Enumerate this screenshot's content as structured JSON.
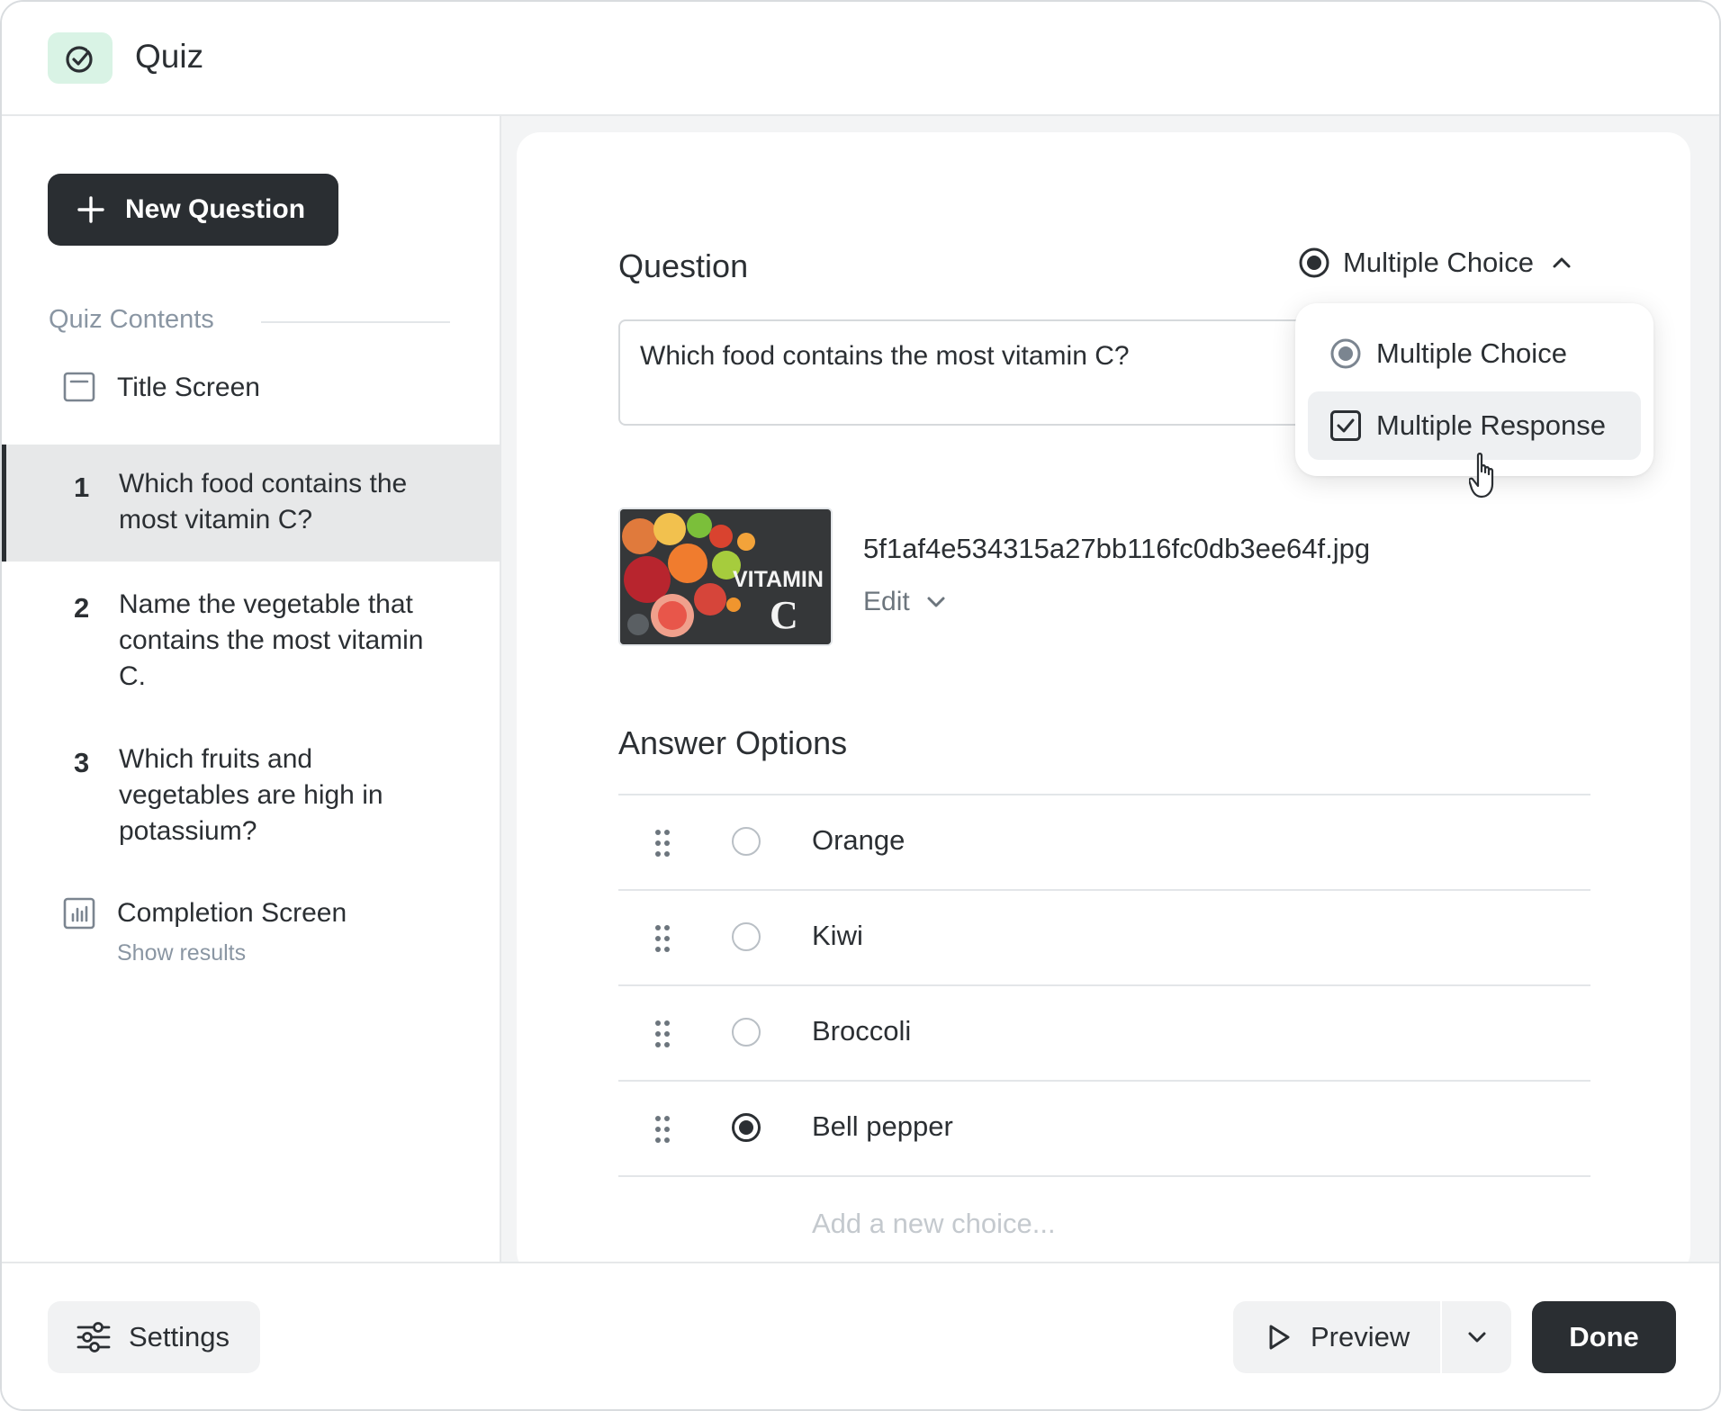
{
  "app": {
    "title": "Quiz",
    "icon": "check-circle-icon",
    "accent_color": "#d9f3e5"
  },
  "sidebar": {
    "new_question_label": "New Question",
    "contents_label": "Quiz Contents",
    "items": [
      {
        "type": "title",
        "label": "Title Screen",
        "icon": "title-screen-icon"
      },
      {
        "type": "question",
        "num": "1",
        "label": "Which food contains the most vitamin C?",
        "selected": true
      },
      {
        "type": "question",
        "num": "2",
        "label": "Name the vegetable that contains the most vitamin C."
      },
      {
        "type": "question",
        "num": "3",
        "label": "Which fruits and vegetables are high in potassium?"
      },
      {
        "type": "completion",
        "label": "Completion Screen",
        "sub_label": "Show results",
        "icon": "bar-chart-icon"
      }
    ]
  },
  "editor": {
    "question_heading": "Question",
    "type_selected": "Multiple Choice",
    "question_text": "Which food contains the most vitamin C?",
    "type_menu": {
      "options": [
        {
          "label": "Multiple Choice",
          "icon": "radio-icon"
        },
        {
          "label": "Multiple Response",
          "icon": "checkbox-icon",
          "hovered": true
        }
      ]
    },
    "image": {
      "file_name": "5f1af4e534315a27bb116fc0db3ee64f.jpg",
      "edit_label": "Edit",
      "thumb_text_1": "VITAMIN",
      "thumb_text_2": "C"
    },
    "answers_heading": "Answer Options",
    "answers": [
      {
        "text": "Orange",
        "correct": false
      },
      {
        "text": "Kiwi",
        "correct": false
      },
      {
        "text": "Broccoli",
        "correct": false
      },
      {
        "text": "Bell pepper",
        "correct": true
      }
    ],
    "add_choice_placeholder": "Add a new choice..."
  },
  "footer": {
    "settings_label": "Settings",
    "preview_label": "Preview",
    "done_label": "Done"
  }
}
